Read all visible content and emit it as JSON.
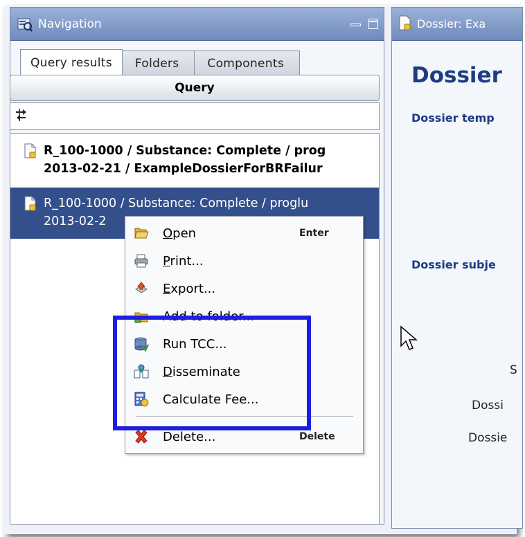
{
  "navigation": {
    "title": "Navigation",
    "tabs": [
      {
        "label": "Query results",
        "active": true
      },
      {
        "label": "Folders",
        "active": false
      },
      {
        "label": "Components",
        "active": false
      }
    ],
    "query_button": "Query",
    "results": [
      {
        "line1": "R_100-1000 / Substance: Complete / prog",
        "line2": "2013-02-21 / ExampleDossierForBRFailur",
        "selected": false
      },
      {
        "line1": "R_100-1000 / Substance: Complete / proglu",
        "line2": "2013-02-2",
        "selected": true
      }
    ]
  },
  "dossier": {
    "tab_title": "Dossier: Exa",
    "heading": "Dossier",
    "template_label": "Dossier temp",
    "subject_label": "Dossier subje",
    "field_s": "S",
    "field_dossi": "Dossi",
    "field_dossie": "Dossie"
  },
  "context_menu": {
    "items": [
      {
        "label_u": "O",
        "label_rest": "pen",
        "shortcut": "Enter",
        "icon": "folder-open-icon"
      },
      {
        "label_u": "P",
        "label_rest": "rint...",
        "shortcut": "",
        "icon": "printer-icon"
      },
      {
        "label_u": "E",
        "label_rest": "xport...",
        "shortcut": "",
        "icon": "export-icon"
      },
      {
        "label_u": "",
        "label_rest": "Add to folder...",
        "shortcut": "",
        "icon": "add-to-folder-icon"
      },
      {
        "label_u": "",
        "label_rest": "Run TCC...",
        "shortcut": "",
        "icon": "run-tcc-icon"
      },
      {
        "label_u": "D",
        "label_rest": "isseminate",
        "shortcut": "",
        "icon": "disseminate-icon"
      },
      {
        "label_u": "",
        "label_rest": "Calculate Fee...",
        "shortcut": "",
        "icon": "calculate-fee-icon"
      },
      {
        "label_u": "",
        "label_rest": "Delete...",
        "shortcut": "Delete",
        "icon": "delete-icon"
      }
    ]
  },
  "colors": {
    "selection": "#34508c",
    "highlight_frame": "#1d1fe0",
    "title_bar": "#7f98c6",
    "heading_blue": "#1e3c82"
  }
}
